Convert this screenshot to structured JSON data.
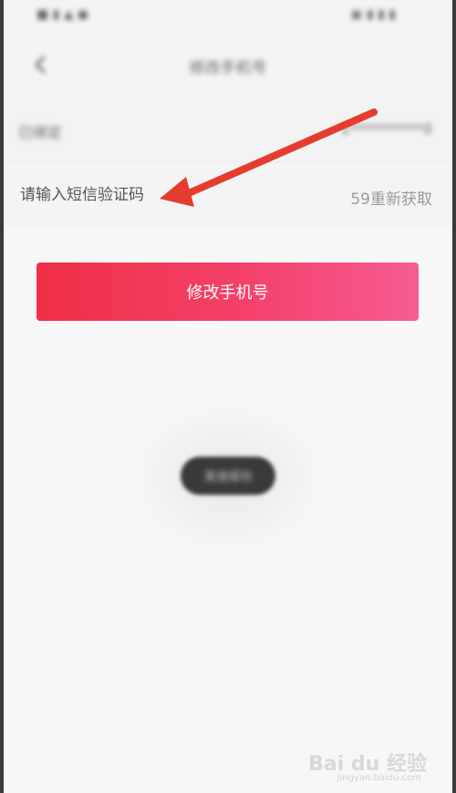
{
  "status_bar": {
    "left_text": "■ ▮ ▲ ◼ ",
    "right_text": "▣ ▮ ▮ ▮"
  },
  "nav": {
    "title": "修改手机号"
  },
  "phone_row": {
    "label": "已绑定",
    "value": "1**********0"
  },
  "code_row": {
    "placeholder": "请输入短信验证码",
    "resend": "59重新获取"
  },
  "submit": {
    "label": "修改手机号"
  },
  "toast": {
    "text": "发送成功"
  },
  "colors": {
    "accent_start": "#ef2f45",
    "accent_end": "#f65c93",
    "annotation_arrow": "#e43d2f"
  },
  "icons": {
    "back": "back-chevron-icon"
  },
  "watermark": {
    "brand": "Bai du 经验",
    "url": "jingyan.baidu.com"
  }
}
